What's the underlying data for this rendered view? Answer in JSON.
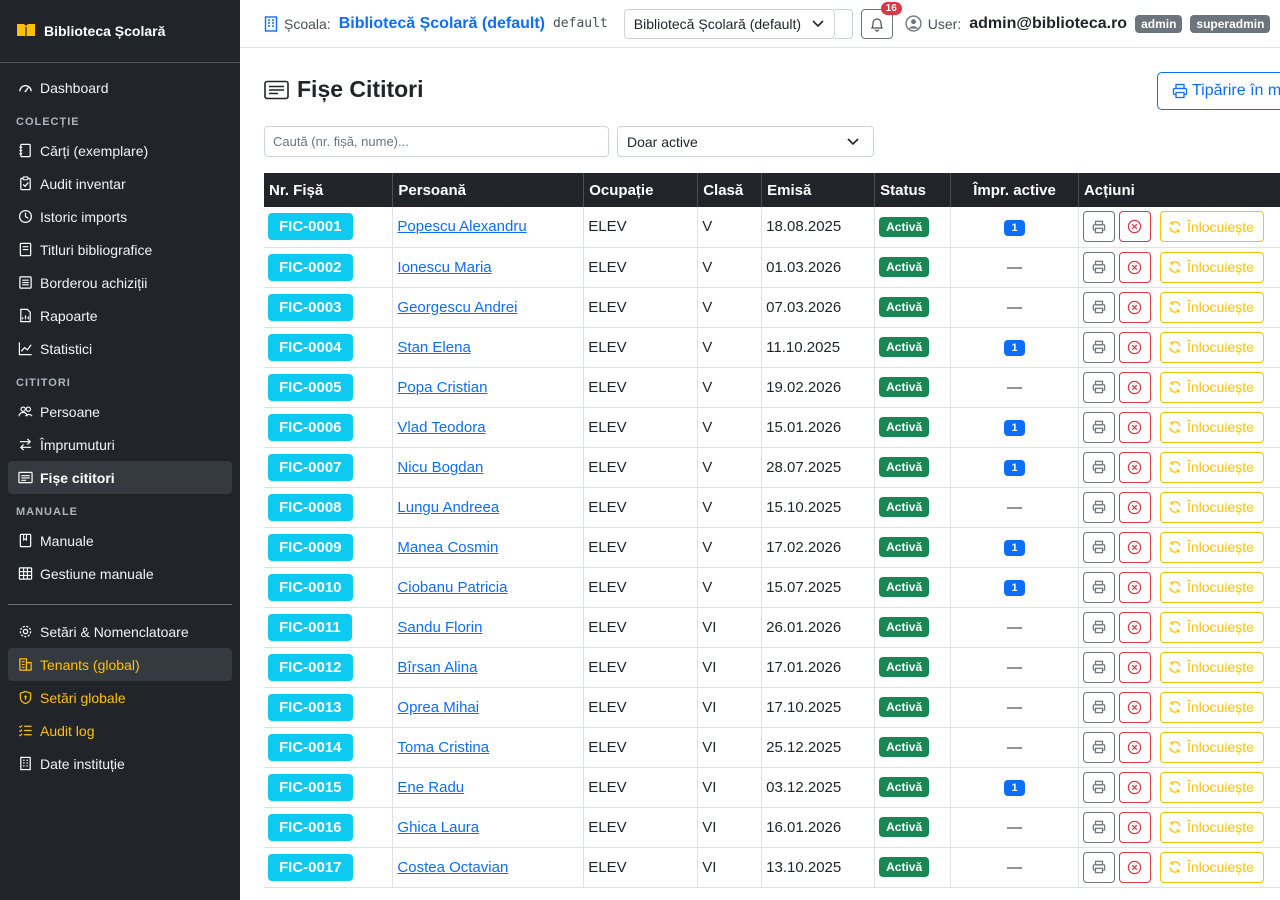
{
  "brand": "Biblioteca Școlară",
  "sidebar": {
    "dashboard": "Dashboard",
    "section_colectie": "COLECȚIE",
    "carti": "Cărți (exemplare)",
    "audit_inventar": "Audit inventar",
    "istoric_imports": "Istoric imports",
    "titluri": "Titluri bibliografice",
    "borderou": "Borderou achiziții",
    "rapoarte": "Rapoarte",
    "statistici": "Statistici",
    "section_cititori": "CITITORI",
    "persoane": "Persoane",
    "imprumuturi": "Împrumuturi",
    "fise": "Fișe cititori",
    "section_manuale": "MANUALE",
    "manuale": "Manuale",
    "gestiune_manuale": "Gestiune manuale",
    "setari_nomenclatoare": "Setări & Nomenclatoare",
    "tenants": "Tenants (global)",
    "setari_globale": "Setări globale",
    "audit_log": "Audit log",
    "date_institutie": "Date instituție"
  },
  "topbar": {
    "school_label": "Școala:",
    "school_name": "Bibliotecă Școlară (default)",
    "school_code": "default",
    "school_select": "Bibliotecă Școlară (default)",
    "notification_count": "16",
    "user_label": "User:",
    "user_email": "admin@biblioteca.ro",
    "badge_admin": "admin",
    "badge_superadmin": "superadmin"
  },
  "page": {
    "title": "Fișe Cititori",
    "print_button": "Tipărire în m",
    "search_placeholder": "Caută (nr. fișă, nume)...",
    "filter_value": "Doar active"
  },
  "table": {
    "headers": {
      "nr_fisa": "Nr. Fișă",
      "persoana": "Persoană",
      "ocupatie": "Ocupație",
      "clasa": "Clasă",
      "emisa": "Emisă",
      "status": "Status",
      "impr_active": "Împr. active",
      "actiuni": "Acțiuni"
    },
    "replace_label": "Înlocuiește",
    "rows": [
      {
        "fisa": "FIC-0001",
        "persoana": "Popescu Alexandru",
        "ocupatie": "ELEV",
        "clasa": "V",
        "emisa": "18.08.2025",
        "status": "Activă",
        "impr": "1"
      },
      {
        "fisa": "FIC-0002",
        "persoana": "Ionescu Maria",
        "ocupatie": "ELEV",
        "clasa": "V",
        "emisa": "01.03.2026",
        "status": "Activă",
        "impr": "—"
      },
      {
        "fisa": "FIC-0003",
        "persoana": "Georgescu Andrei",
        "ocupatie": "ELEV",
        "clasa": "V",
        "emisa": "07.03.2026",
        "status": "Activă",
        "impr": "—"
      },
      {
        "fisa": "FIC-0004",
        "persoana": "Stan Elena",
        "ocupatie": "ELEV",
        "clasa": "V",
        "emisa": "11.10.2025",
        "status": "Activă",
        "impr": "1"
      },
      {
        "fisa": "FIC-0005",
        "persoana": "Popa Cristian",
        "ocupatie": "ELEV",
        "clasa": "V",
        "emisa": "19.02.2026",
        "status": "Activă",
        "impr": "—"
      },
      {
        "fisa": "FIC-0006",
        "persoana": "Vlad Teodora",
        "ocupatie": "ELEV",
        "clasa": "V",
        "emisa": "15.01.2026",
        "status": "Activă",
        "impr": "1"
      },
      {
        "fisa": "FIC-0007",
        "persoana": "Nicu Bogdan",
        "ocupatie": "ELEV",
        "clasa": "V",
        "emisa": "28.07.2025",
        "status": "Activă",
        "impr": "1"
      },
      {
        "fisa": "FIC-0008",
        "persoana": "Lungu Andreea",
        "ocupatie": "ELEV",
        "clasa": "V",
        "emisa": "15.10.2025",
        "status": "Activă",
        "impr": "—"
      },
      {
        "fisa": "FIC-0009",
        "persoana": "Manea Cosmin",
        "ocupatie": "ELEV",
        "clasa": "V",
        "emisa": "17.02.2026",
        "status": "Activă",
        "impr": "1"
      },
      {
        "fisa": "FIC-0010",
        "persoana": "Ciobanu Patricia",
        "ocupatie": "ELEV",
        "clasa": "V",
        "emisa": "15.07.2025",
        "status": "Activă",
        "impr": "1"
      },
      {
        "fisa": "FIC-0011",
        "persoana": "Sandu Florin",
        "ocupatie": "ELEV",
        "clasa": "VI",
        "emisa": "26.01.2026",
        "status": "Activă",
        "impr": "—"
      },
      {
        "fisa": "FIC-0012",
        "persoana": "Bîrsan Alina",
        "ocupatie": "ELEV",
        "clasa": "VI",
        "emisa": "17.01.2026",
        "status": "Activă",
        "impr": "—"
      },
      {
        "fisa": "FIC-0013",
        "persoana": "Oprea Mihai",
        "ocupatie": "ELEV",
        "clasa": "VI",
        "emisa": "17.10.2025",
        "status": "Activă",
        "impr": "—"
      },
      {
        "fisa": "FIC-0014",
        "persoana": "Toma Cristina",
        "ocupatie": "ELEV",
        "clasa": "VI",
        "emisa": "25.12.2025",
        "status": "Activă",
        "impr": "—"
      },
      {
        "fisa": "FIC-0015",
        "persoana": "Ene Radu",
        "ocupatie": "ELEV",
        "clasa": "VI",
        "emisa": "03.12.2025",
        "status": "Activă",
        "impr": "1"
      },
      {
        "fisa": "FIC-0016",
        "persoana": "Ghica Laura",
        "ocupatie": "ELEV",
        "clasa": "VI",
        "emisa": "16.01.2026",
        "status": "Activă",
        "impr": "—"
      },
      {
        "fisa": "FIC-0017",
        "persoana": "Costea Octavian",
        "ocupatie": "ELEV",
        "clasa": "VI",
        "emisa": "13.10.2025",
        "status": "Activă",
        "impr": "—"
      }
    ]
  },
  "colors": {
    "sidebar_bg": "#212529",
    "accent": "#0d6efd",
    "fic_badge": "#0dcaf0",
    "status_active": "#198754",
    "danger": "#dc3545",
    "warning": "#ffc107"
  }
}
